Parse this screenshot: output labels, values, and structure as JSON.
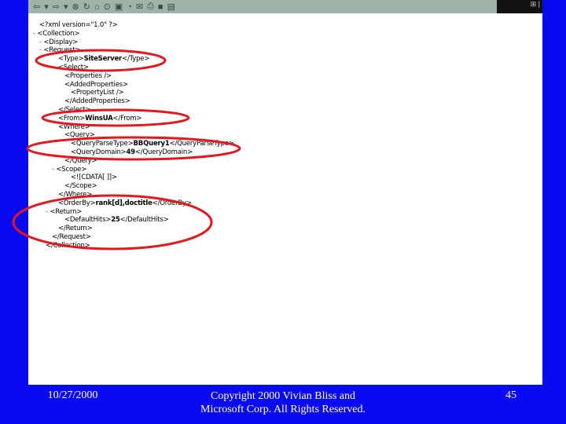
{
  "toolbar": {
    "icons": [
      "back-icon",
      "dropdown-icon",
      "forward-icon",
      "dropdown-icon",
      "stop-icon",
      "refresh-icon",
      "home-icon",
      "search-icon",
      "favorites-icon",
      "history-icon",
      "mail-icon",
      "print-icon",
      "edit-icon",
      "discuss-icon"
    ]
  },
  "xml_lines": [
    {
      "indent": 0,
      "minus": "",
      "pre": "<?xml version=\"1.0\" ?>",
      "bold": "",
      "post": ""
    },
    {
      "indent": 0,
      "minus": "- ",
      "pre": "<Collection>",
      "bold": "",
      "post": ""
    },
    {
      "indent": 1,
      "minus": "- ",
      "pre": "<Display>",
      "bold": "",
      "post": ""
    },
    {
      "indent": 1,
      "minus": "- ",
      "pre": "<Request>",
      "bold": "",
      "post": ""
    },
    {
      "indent": 3,
      "minus": "",
      "pre": "<Type>",
      "bold": "SiteServer",
      "post": "</Type>"
    },
    {
      "indent": 3,
      "minus": "",
      "pre": "<Select>",
      "bold": "",
      "post": ""
    },
    {
      "indent": 4,
      "minus": "",
      "pre": "<Properties />",
      "bold": "",
      "post": ""
    },
    {
      "indent": 4,
      "minus": "",
      "pre": "<AddedProperties>",
      "bold": "",
      "post": ""
    },
    {
      "indent": 5,
      "minus": "",
      "pre": "<PropertyList />",
      "bold": "",
      "post": ""
    },
    {
      "indent": 4,
      "minus": "",
      "pre": "</AddedProperties>",
      "bold": "",
      "post": ""
    },
    {
      "indent": 3,
      "minus": "",
      "pre": "</Select>",
      "bold": "",
      "post": ""
    },
    {
      "indent": 3,
      "minus": "",
      "pre": "<From>",
      "bold": "WinsUA",
      "post": "</From>"
    },
    {
      "indent": 3,
      "minus": "",
      "pre": "<Where>",
      "bold": "",
      "post": ""
    },
    {
      "indent": 4,
      "minus": "",
      "pre": "<Query>",
      "bold": "",
      "post": ""
    },
    {
      "indent": 5,
      "minus": "",
      "pre": "<QueryParseType>",
      "bold": "BBQuery1",
      "post": "</QueryParseType>"
    },
    {
      "indent": 5,
      "minus": "",
      "pre": "<QueryDomain>",
      "bold": "49",
      "post": "</QueryDomain>"
    },
    {
      "indent": 4,
      "minus": "",
      "pre": "</Query>",
      "bold": "",
      "post": ""
    },
    {
      "indent": 3,
      "minus": "- ",
      "pre": "<Scope>",
      "bold": "",
      "post": ""
    },
    {
      "indent": 5,
      "minus": "",
      "pre": "<![CDATA[ ]]>",
      "bold": "",
      "post": ""
    },
    {
      "indent": 4,
      "minus": "",
      "pre": "</Scope>",
      "bold": "",
      "post": ""
    },
    {
      "indent": 3,
      "minus": "",
      "pre": "</Where>",
      "bold": "",
      "post": ""
    },
    {
      "indent": 3,
      "minus": "",
      "pre": "<OrderBy>",
      "bold": "rank[d],doctitle",
      "post": "</OrderBy>"
    },
    {
      "indent": 2,
      "minus": "- ",
      "pre": "<Return>",
      "bold": "",
      "post": ""
    },
    {
      "indent": 4,
      "minus": "",
      "pre": "<DefaultHits>",
      "bold": "25",
      "post": "</DefaultHits>"
    },
    {
      "indent": 3,
      "minus": "",
      "pre": "</Return>",
      "bold": "",
      "post": ""
    },
    {
      "indent": 2,
      "minus": "",
      "pre": "</Request>",
      "bold": "",
      "post": ""
    },
    {
      "indent": 1,
      "minus": "",
      "pre": "</Collection>",
      "bold": "",
      "post": ""
    }
  ],
  "footer": {
    "date": "10/27/2000",
    "copyright_line1": "Copyright 2000 Vivian Bliss and",
    "copyright_line2": "Microsoft Corp. All Rights Reserved.",
    "page": "45"
  },
  "colors": {
    "background": "#0a0af0",
    "highlight": "#e8161c"
  }
}
